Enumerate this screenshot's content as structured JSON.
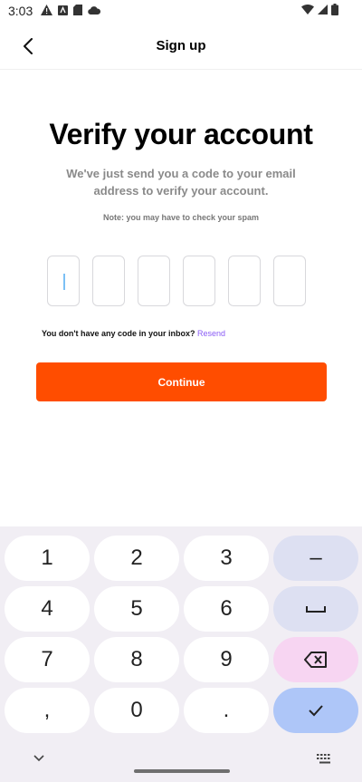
{
  "status_bar": {
    "time": "3:03"
  },
  "header": {
    "title": "Sign up"
  },
  "main": {
    "heading": "Verify your account",
    "subtitle": "We've just send you a code to your email address to verify your account.",
    "note": "Note: you may have to check your spam",
    "code_boxes": [
      "",
      "",
      "",
      "",
      "",
      ""
    ],
    "resend_prompt": "You don't have any code in your inbox?",
    "resend_link": "Resend",
    "continue_label": "Continue"
  },
  "keyboard": {
    "keys": {
      "k1": "1",
      "k2": "2",
      "k3": "3",
      "k4": "4",
      "k5": "5",
      "k6": "6",
      "k7": "7",
      "k8": "8",
      "k9": "9",
      "comma": ",",
      "k0": "0",
      "period": ".",
      "minus": "–"
    }
  },
  "colors": {
    "accent": "#ff4d00",
    "link": "#8a5cf5",
    "cursor": "#7cc0f5",
    "keyboard_bg": "#f1eef4",
    "key_side": "#dde0f2",
    "key_delete": "#f7d5f2",
    "key_enter": "#aec6f8"
  }
}
